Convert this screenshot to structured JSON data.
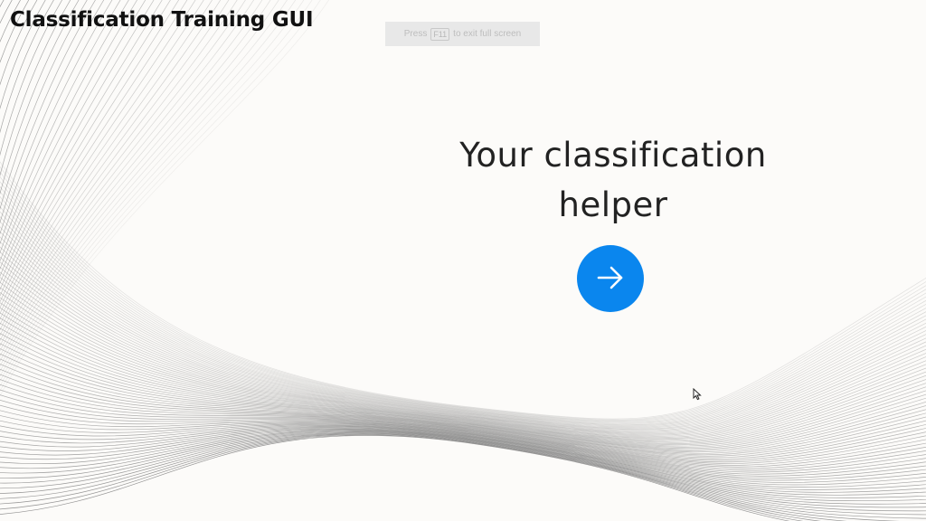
{
  "app": {
    "title": "Classification Training GUI"
  },
  "fullscreen_notice": {
    "before": "Press",
    "key": "F11",
    "after": "to exit full screen"
  },
  "hero": {
    "heading": "Your classification helper"
  },
  "start_button": {
    "icon": "arrow-right-icon",
    "color": "#0a86ee"
  },
  "colors": {
    "background": "#fcfbf9",
    "wave_lines": "#7a7a7a",
    "accent": "#0a86ee"
  }
}
